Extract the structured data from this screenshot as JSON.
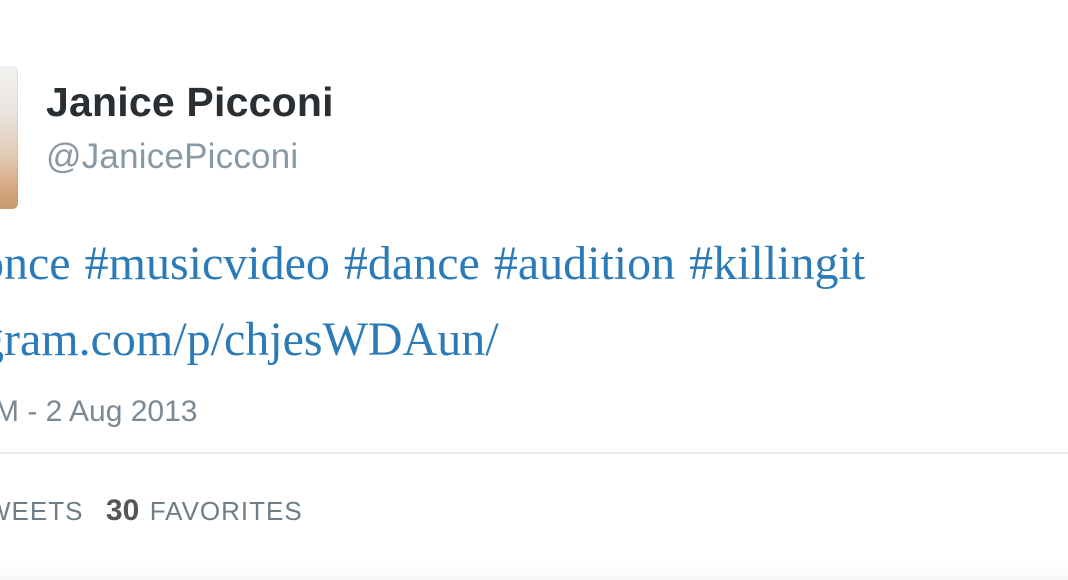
{
  "tweet": {
    "author": {
      "name": "Janice Picconi",
      "handle": "@JanicePicconi"
    },
    "text": {
      "hashtags": [
        "once",
        "#musicvideo",
        "#dance",
        "#audition",
        "#killingit"
      ],
      "link": "gram.com/p/chjesWDAun/"
    },
    "timestamp": "M - 2 Aug 2013",
    "stats": {
      "retweets_label": "WEETS",
      "favorites_count": "30",
      "favorites_label": "FAVORITES"
    }
  },
  "colors": {
    "link": "#2b7bb9",
    "name": "#292f33",
    "handle": "#8899a6",
    "meta": "#7a8994",
    "divider": "#e8ebed"
  }
}
